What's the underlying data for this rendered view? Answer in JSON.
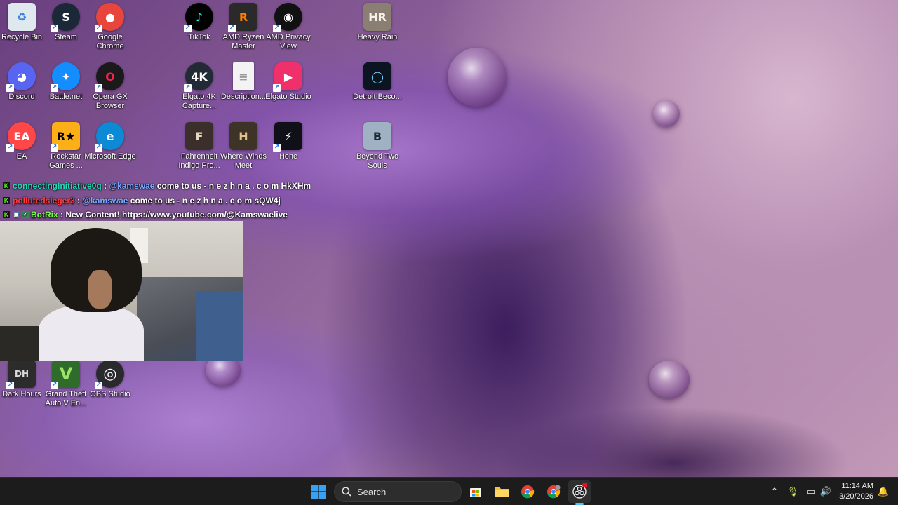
{
  "desktop": {
    "icons": [
      {
        "label": "Recycle Bin",
        "glyph": "♻",
        "bg": "#dfe7ef",
        "fg": "#3b7fd8",
        "icon": "recycle-bin-icon"
      },
      {
        "label": "Steam",
        "glyph": "S",
        "bg": "#1b2838",
        "fg": "#ffffff",
        "icon": "steam-icon"
      },
      {
        "label": "Google Chrome",
        "glyph": "●",
        "bg": "#e8453c",
        "fg": "#ffffff",
        "icon": "chrome-icon"
      },
      {
        "label": "TikTok",
        "glyph": "♪",
        "bg": "#010101",
        "fg": "#25f4ee",
        "icon": "tiktok-icon"
      },
      {
        "label": "AMD Ryzen Master",
        "glyph": "R",
        "bg": "#2a2a2a",
        "fg": "#ff7a00",
        "icon": "ryzen-master-icon"
      },
      {
        "label": "AMD Privacy View",
        "glyph": "◉",
        "bg": "#111111",
        "fg": "#ffffff",
        "icon": "amd-privacy-icon"
      },
      {
        "label": "Heavy Rain",
        "glyph": "HR",
        "bg": "#8b7f74",
        "fg": "#f5f0e8",
        "icon": "heavy-rain-icon"
      },
      {
        "label": "Discord",
        "glyph": "◕",
        "bg": "#5865f2",
        "fg": "#ffffff",
        "icon": "discord-icon"
      },
      {
        "label": "Battle.net",
        "glyph": "✦",
        "bg": "#148eff",
        "fg": "#ffffff",
        "icon": "battlenet-icon"
      },
      {
        "label": "Opera GX Browser",
        "glyph": "O",
        "bg": "#1a1a1a",
        "fg": "#fa1e4e",
        "icon": "opera-gx-icon"
      },
      {
        "label": "Elgato 4K Capture...",
        "glyph": "4K",
        "bg": "#222a35",
        "fg": "#ffffff",
        "icon": "elgato-4k-icon"
      },
      {
        "label": "Description...",
        "glyph": "≡",
        "bg": "#f3f3f3",
        "fg": "#9a9a9a",
        "icon": "text-file-icon"
      },
      {
        "label": "Elgato Studio",
        "glyph": "▶",
        "bg": "#f0306a",
        "fg": "#ffffff",
        "icon": "elgato-studio-icon"
      },
      {
        "label": "Detroit Beco...",
        "glyph": "◯",
        "bg": "#0b1420",
        "fg": "#6fd3ff",
        "icon": "detroit-icon"
      },
      {
        "label": "EA",
        "glyph": "EA",
        "bg": "#ff4747",
        "fg": "#ffffff",
        "icon": "ea-icon"
      },
      {
        "label": "Rockstar Games ...",
        "glyph": "R★",
        "bg": "#fcaf17",
        "fg": "#000000",
        "icon": "rockstar-icon"
      },
      {
        "label": "Microsoft Edge",
        "glyph": "e",
        "bg": "#0c8ad6",
        "fg": "#ffffff",
        "icon": "edge-icon"
      },
      {
        "label": "Fahrenheit Indigo Pro...",
        "glyph": "F",
        "bg": "#3a2f2a",
        "fg": "#e8d7c0",
        "icon": "fahrenheit-icon"
      },
      {
        "label": "Where Winds Meet",
        "glyph": "H",
        "bg": "#3d3326",
        "fg": "#e2c48a",
        "icon": "where-winds-meet-icon"
      },
      {
        "label": "Hone",
        "glyph": "⚡",
        "bg": "#101018",
        "fg": "#ffffff",
        "icon": "hone-icon"
      },
      {
        "label": "Beyond Two Souls",
        "glyph": "B",
        "bg": "#9fb2c3",
        "fg": "#1e2a36",
        "icon": "beyond-two-souls-icon"
      },
      {
        "label": "Dark Hours",
        "glyph": "DH",
        "bg": "#2c2c2c",
        "fg": "#dcdcdc",
        "icon": "dark-hours-icon"
      },
      {
        "label": "Grand Theft Auto V En...",
        "glyph": "V",
        "bg": "#2f6b2a",
        "fg": "#9ee26a",
        "icon": "gta-v-icon"
      },
      {
        "label": "OBS Studio",
        "glyph": "◎",
        "bg": "#2a2a2e",
        "fg": "#ffffff",
        "icon": "obs-icon"
      }
    ]
  },
  "chat": {
    "lines": [
      {
        "user": "connectingInitiative0q",
        "user_color": "#27d7b7",
        "mention": "@kamswae",
        "message": "come to us - n e z h n a . c o m HkXHm"
      },
      {
        "user": "pollutedsieger3",
        "user_color": "#ff3b3b",
        "mention": "@kamswae",
        "message": "come to us - n e z h n a . c o m sQW4j"
      },
      {
        "user": "BotRix",
        "user_color": "#7bff4e",
        "mention": "",
        "message": "New Content! https://www.youtube.com/@Kamswaelive"
      }
    ]
  },
  "taskbar": {
    "search_label": "Search",
    "time": "11:14 AM",
    "date": "3/20/2026"
  },
  "colors": {
    "taskbar_bg": "#1c1c1c",
    "accent": "#0078d4",
    "mention": "#7aa7ff"
  }
}
